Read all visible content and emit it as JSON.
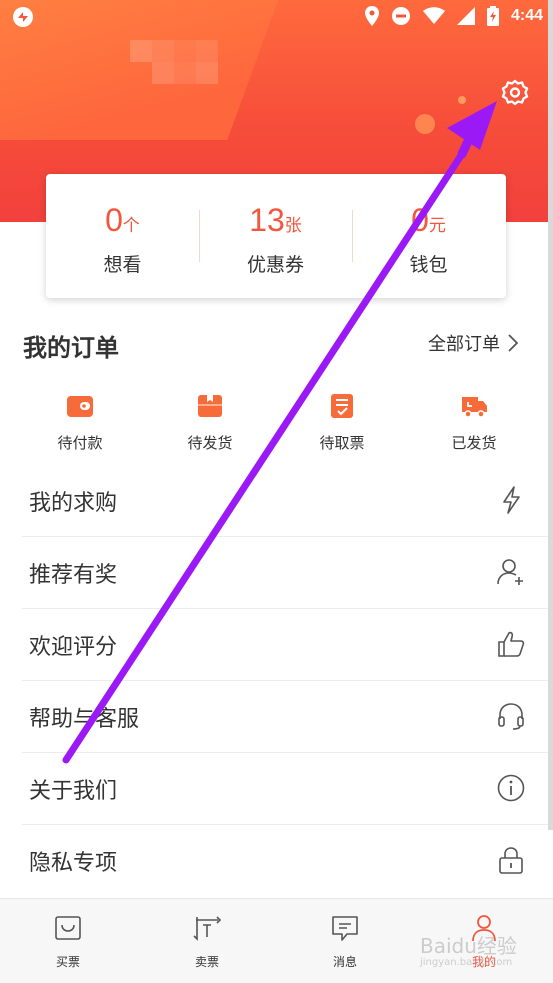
{
  "status_bar": {
    "time": "4:44",
    "icons": [
      "location-icon",
      "do-not-disturb-icon",
      "wifi-icon",
      "signal-icon",
      "battery-charging-icon"
    ]
  },
  "header": {
    "settings_icon": "gear-icon"
  },
  "stats": [
    {
      "value": "0",
      "unit": "个",
      "label": "想看"
    },
    {
      "value": "13",
      "unit": "张",
      "label": "优惠券"
    },
    {
      "value": "0",
      "unit": "元",
      "label": "钱包"
    }
  ],
  "orders": {
    "title": "我的订单",
    "all_label": "全部订单",
    "items": [
      {
        "label": "待付款",
        "icon": "wallet-icon"
      },
      {
        "label": "待发货",
        "icon": "package-icon"
      },
      {
        "label": "待取票",
        "icon": "ticket-icon"
      },
      {
        "label": "已发货",
        "icon": "truck-icon"
      }
    ]
  },
  "menu": [
    {
      "label": "我的求购",
      "icon": "lightning-icon"
    },
    {
      "label": "推荐有奖",
      "icon": "user-add-icon"
    },
    {
      "label": "欢迎评分",
      "icon": "thumbs-up-icon"
    },
    {
      "label": "帮助与客服",
      "icon": "headset-icon"
    },
    {
      "label": "关于我们",
      "icon": "info-icon"
    },
    {
      "label": "隐私专项",
      "icon": "lock-icon"
    }
  ],
  "tabbar": [
    {
      "label": "买票",
      "icon": "buy-ticket-icon",
      "active": false
    },
    {
      "label": "卖票",
      "icon": "sell-ticket-icon",
      "active": false
    },
    {
      "label": "消息",
      "icon": "message-icon",
      "active": false
    },
    {
      "label": "我的",
      "icon": "profile-icon",
      "active": true
    }
  ],
  "watermark": {
    "text": "Baidu经验",
    "sub": "jingyan.baidu.com"
  },
  "colors": {
    "accent": "#f2563c",
    "header_top": "#ff6a3d",
    "header_bottom": "#f2413d",
    "annotation_arrow": "#9b19f5"
  }
}
